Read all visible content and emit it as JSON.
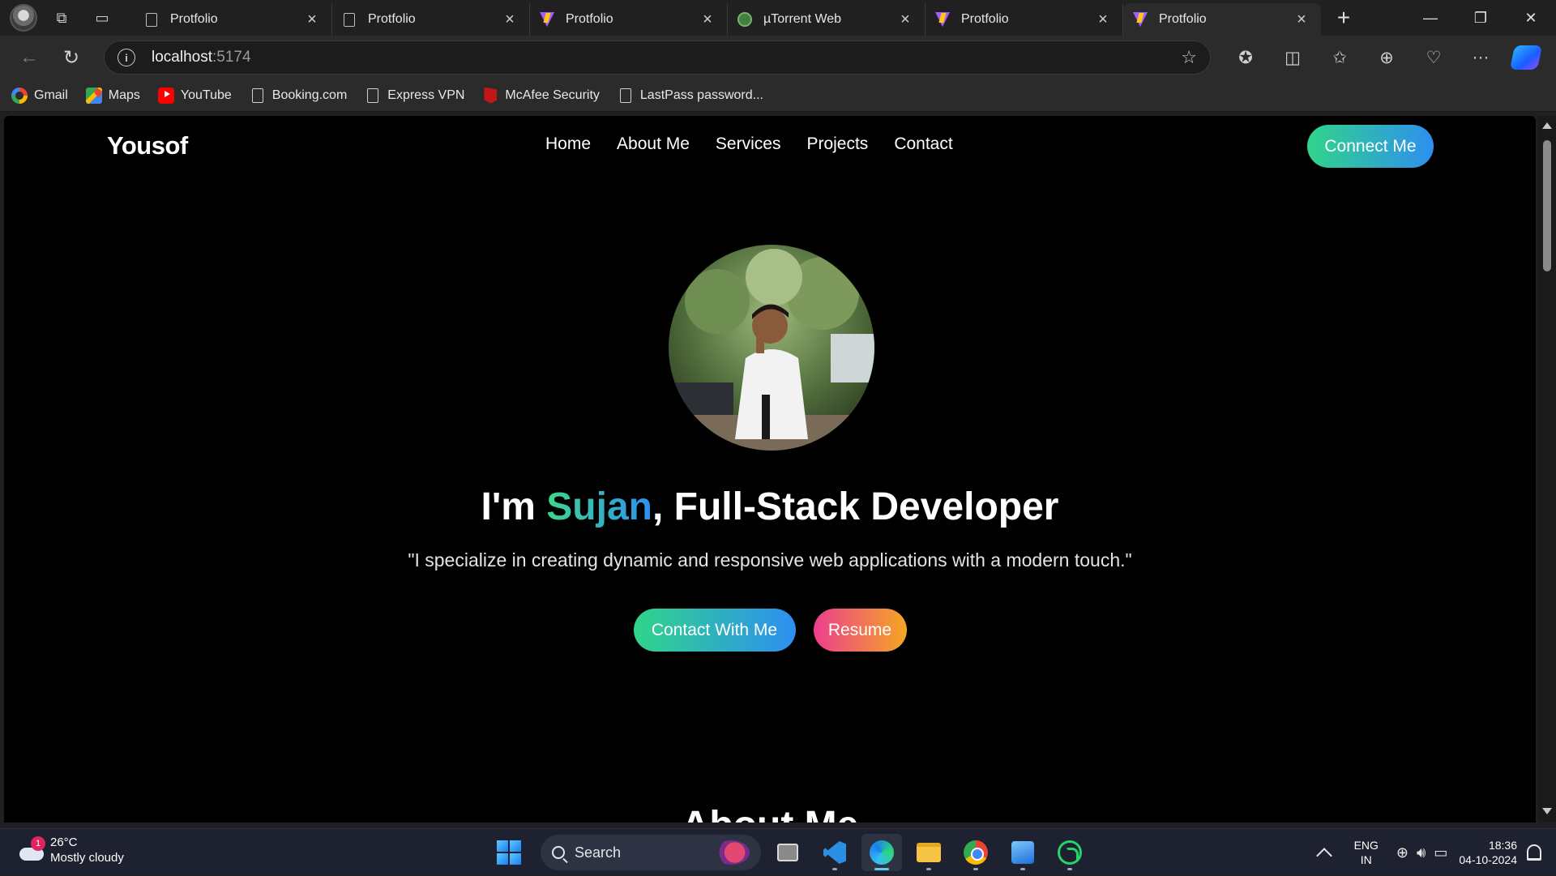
{
  "browser": {
    "tabs": [
      {
        "title": "Protfolio",
        "favicon": "page-icon",
        "active": false
      },
      {
        "title": "Protfolio",
        "favicon": "page-icon",
        "active": false
      },
      {
        "title": "Protfolio",
        "favicon": "vite-icon",
        "active": false
      },
      {
        "title": "µTorrent Web",
        "favicon": "utorrent-icon",
        "active": false
      },
      {
        "title": "Protfolio",
        "favicon": "vite-icon",
        "active": false
      },
      {
        "title": "Protfolio",
        "favicon": "vite-icon",
        "active": true
      }
    ],
    "address": {
      "host": "localhost",
      "port": ":5174"
    },
    "bookmarks": [
      {
        "label": "Gmail",
        "icon": "google-icon"
      },
      {
        "label": "Maps",
        "icon": "maps-icon"
      },
      {
        "label": "YouTube",
        "icon": "youtube-icon"
      },
      {
        "label": "Booking.com",
        "icon": "page-icon"
      },
      {
        "label": "Express VPN",
        "icon": "page-icon"
      },
      {
        "label": "McAfee Security",
        "icon": "mcafee-icon"
      },
      {
        "label": "LastPass password...",
        "icon": "page-icon"
      }
    ]
  },
  "page": {
    "logo": "Yousof",
    "nav": [
      "Home",
      "About Me",
      "Services",
      "Projects",
      "Contact"
    ],
    "connect_button": "Connect Me",
    "headline": {
      "prefix": "I'm ",
      "name": "Sujan",
      "suffix": ", Full-Stack Developer"
    },
    "tagline": "\"I specialize in creating dynamic and responsive web applications with a modern touch.\"",
    "contact_button": "Contact With Me",
    "resume_button": "Resume",
    "next_section_heading": "About Me",
    "colors": {
      "gradient_green": "#31d48a",
      "gradient_blue": "#2d8ff0",
      "gradient_pink": "#ec3f8f",
      "gradient_orange": "#f5a623"
    }
  },
  "taskbar": {
    "weather": {
      "badge": "1",
      "temp": "26°C",
      "condition": "Mostly cloudy"
    },
    "search_label": "Search",
    "language": {
      "lang": "ENG",
      "region": "IN"
    },
    "clock": {
      "time": "18:36",
      "date": "04-10-2024"
    }
  }
}
